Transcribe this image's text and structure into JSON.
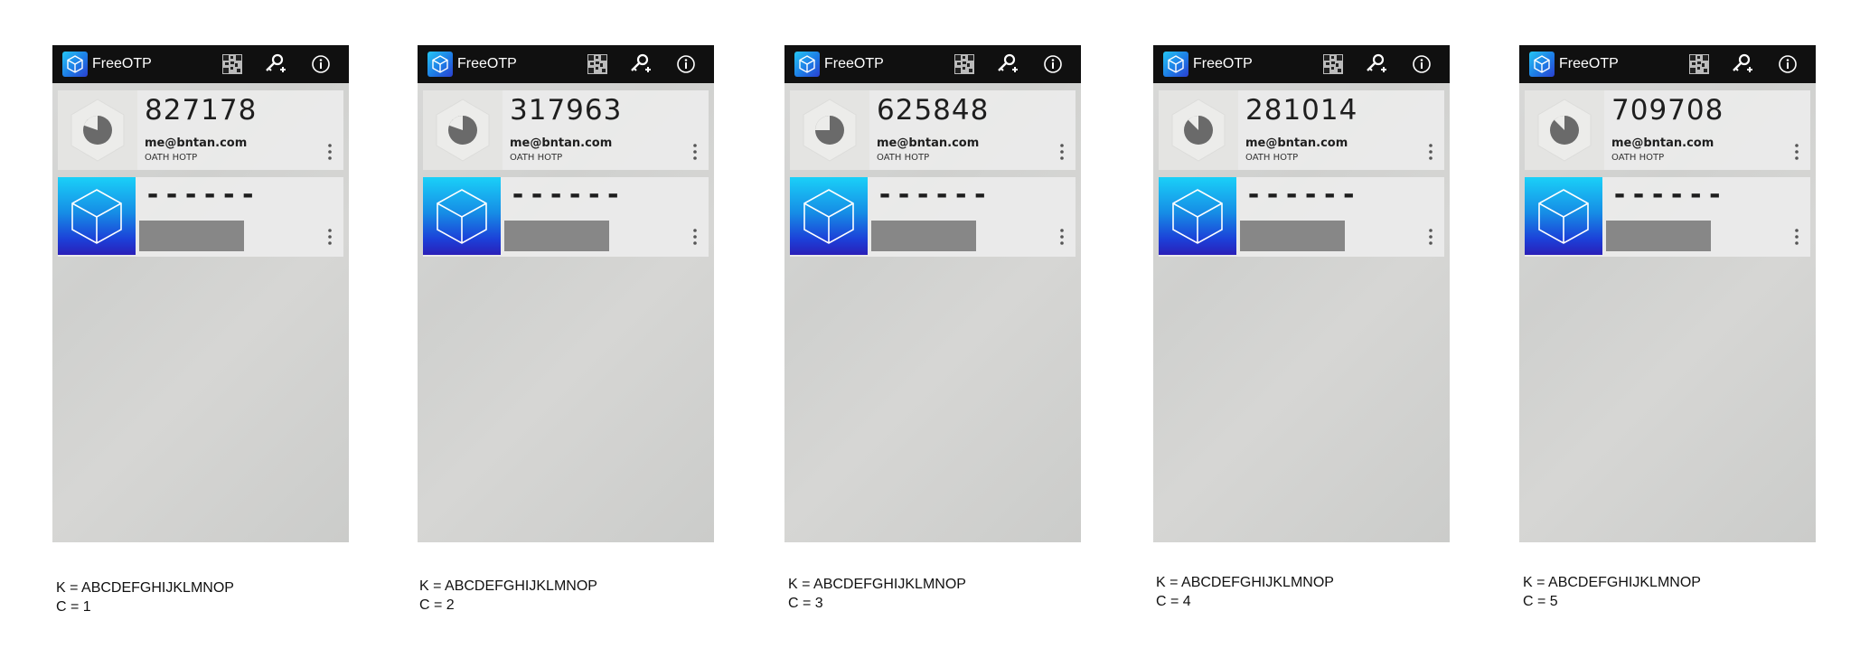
{
  "screens": [
    {
      "app_title": "FreeOTP",
      "token": {
        "code": "827178",
        "account": "me@bntan.com",
        "type": "OATH HOTP"
      },
      "hidden_token": {
        "code": "------"
      },
      "caption": {
        "key": "K = ABCDEFGHIJKLMNOP",
        "counter": "C = 1"
      }
    },
    {
      "app_title": "FreeOTP",
      "token": {
        "code": "317963",
        "account": "me@bntan.com",
        "type": "OATH HOTP"
      },
      "hidden_token": {
        "code": "------"
      },
      "caption": {
        "key": "K = ABCDEFGHIJKLMNOP",
        "counter": "C = 2"
      }
    },
    {
      "app_title": "FreeOTP",
      "token": {
        "code": "625848",
        "account": "me@bntan.com",
        "type": "OATH HOTP"
      },
      "hidden_token": {
        "code": "------"
      },
      "caption": {
        "key": "K = ABCDEFGHIJKLMNOP",
        "counter": "C = 3"
      }
    },
    {
      "app_title": "FreeOTP",
      "token": {
        "code": "281014",
        "account": "me@bntan.com",
        "type": "OATH HOTP"
      },
      "hidden_token": {
        "code": "------"
      },
      "caption": {
        "key": "K = ABCDEFGHIJKLMNOP",
        "counter": "C = 4"
      }
    },
    {
      "app_title": "FreeOTP",
      "token": {
        "code": "709708",
        "account": "me@bntan.com",
        "type": "OATH HOTP"
      },
      "hidden_token": {
        "code": "------"
      },
      "caption": {
        "key": "K = ABCDEFGHIJKLMNOP",
        "counter": "C = 5"
      }
    }
  ],
  "icons": {
    "app_logo": "cube-icon",
    "scan": "qr-code-icon",
    "add": "key-add-icon",
    "about": "info-icon",
    "timer": "timer-pie-icon",
    "menu": "more-vertical-icon"
  },
  "colors": {
    "appbar": "#101010",
    "cube_gradient_top": "#1ad0f8",
    "cube_gradient_bottom": "#2a1fb8",
    "redaction": "#878787"
  }
}
